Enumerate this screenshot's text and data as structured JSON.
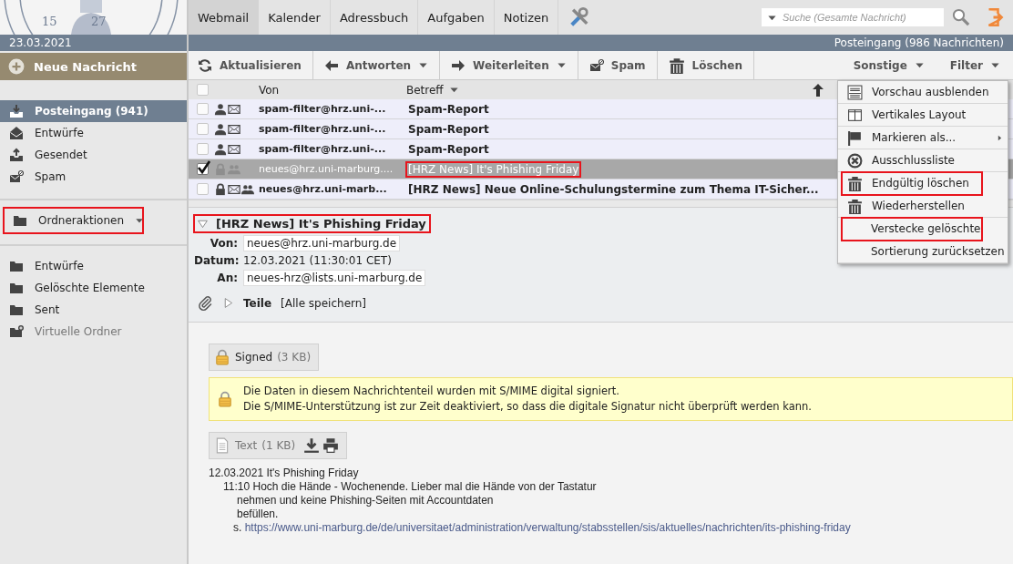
{
  "logo": {
    "numbers": [
      "15",
      "27"
    ]
  },
  "date": "23.03.2021",
  "new_message": "Neue Nachricht",
  "mail_folders": [
    {
      "label": "Posteingang (941)",
      "kind": "inbox",
      "selected": true
    },
    {
      "label": "Entwürfe",
      "kind": "drafts",
      "selected": false
    },
    {
      "label": "Gesendet",
      "kind": "sent",
      "selected": false
    },
    {
      "label": "Spam",
      "kind": "spam",
      "selected": false
    }
  ],
  "folder_actions": {
    "label": "Ordneraktionen",
    "highlighted": true
  },
  "folders": [
    {
      "label": "Entwürfe",
      "kind": "folder",
      "disabled": false
    },
    {
      "label": "Gelöschte Elemente",
      "kind": "folder",
      "disabled": false
    },
    {
      "label": "Sent",
      "kind": "folder",
      "disabled": false
    },
    {
      "label": "Virtuelle Ordner",
      "kind": "virtual",
      "disabled": true
    }
  ],
  "tabs": [
    {
      "label": "Webmail",
      "selected": true
    },
    {
      "label": "Kalender",
      "selected": false
    },
    {
      "label": "Adressbuch",
      "selected": false
    },
    {
      "label": "Aufgaben",
      "selected": false
    },
    {
      "label": "Notizen",
      "selected": false
    }
  ],
  "search": {
    "placeholder": "Suche (Gesamte Nachricht)"
  },
  "mailbox_status": "Posteingang (986 Nachrichten)",
  "toolbar": [
    {
      "label": "Aktualisieren",
      "kind": "refresh",
      "dropdown": false
    },
    {
      "label": "Antworten",
      "kind": "reply",
      "dropdown": true
    },
    {
      "label": "Weiterleiten",
      "kind": "forward",
      "dropdown": true
    },
    {
      "label": "Spam",
      "kind": "spam",
      "dropdown": false
    },
    {
      "label": "Löschen",
      "kind": "trash",
      "dropdown": false
    }
  ],
  "toolbar_right": [
    {
      "label": "Sonstige"
    },
    {
      "label": "Filter"
    }
  ],
  "message_list": {
    "select_all": {
      "checked": false
    },
    "columns": [
      "Von",
      "Betreff"
    ],
    "rows": [
      {
        "from": "spam-filter@hrz.uni-...",
        "subject": "Spam-Report",
        "personal": true,
        "locked": false,
        "mail": true,
        "mailing_list": false,
        "unread": true,
        "checked": false,
        "selected": false,
        "highlighted": false
      },
      {
        "from": "spam-filter@hrz.uni-...",
        "subject": "Spam-Report",
        "personal": true,
        "locked": false,
        "mail": true,
        "mailing_list": false,
        "unread": true,
        "checked": false,
        "selected": false,
        "highlighted": false
      },
      {
        "from": "spam-filter@hrz.uni-...",
        "subject": "Spam-Report",
        "personal": true,
        "locked": false,
        "mail": true,
        "mailing_list": false,
        "unread": true,
        "checked": false,
        "selected": false,
        "highlighted": false
      },
      {
        "from": "neues@hrz.uni-marburg....",
        "subject": "[HRZ News] It's Phishing Friday",
        "personal": false,
        "locked": true,
        "mail": false,
        "mailing_list": true,
        "unread": false,
        "checked": true,
        "selected": true,
        "highlighted": true
      },
      {
        "from": "neues@hrz.uni-marb...",
        "subject": "[HRZ News] Neue Online-Schulungstermine zum Thema IT-Sicher...",
        "personal": false,
        "locked": true,
        "mail": true,
        "mailing_list": true,
        "unread": true,
        "checked": false,
        "selected": false,
        "highlighted": false
      }
    ]
  },
  "preview": {
    "subject": "[HRZ News] It's Phishing Friday",
    "highlighted": true,
    "expanded": true,
    "fields": [
      {
        "label": "Von:",
        "value": "neues@hrz.uni-marburg.de",
        "kind": "address"
      },
      {
        "label": "Datum:",
        "value": "12.03.2021 (11:30:01 CET)",
        "kind": "text"
      },
      {
        "label": "An:",
        "value": "neues-hrz@lists.uni-marburg.de",
        "kind": "address"
      }
    ],
    "parts": {
      "label": "Teile",
      "action": "[Alle speichern]",
      "expanded": false
    }
  },
  "signed_part": {
    "label": "Signed",
    "size": "(3 KB)"
  },
  "notice": [
    "Die Daten in diesem Nachrichtenteil wurden mit S/MIME digital signiert.",
    "Die S/MIME-Unterstützung ist zur Zeit deaktiviert, so dass die digitale Signatur nicht überprüft werden kann."
  ],
  "text_part": {
    "label": "Text",
    "size": "(1 KB)"
  },
  "body": [
    {
      "kind": "plain",
      "text": "12.03.2021 It's Phishing Friday"
    },
    {
      "kind": "indented",
      "text": "11:10 Hoch die Hände - Wochenende. Lieber mal die Hände von der Tastatur"
    },
    {
      "kind": "continued",
      "text": "nehmen und keine Phishing-Seiten mit Accountdaten"
    },
    {
      "kind": "continued",
      "text": "befüllen."
    },
    {
      "kind": "link",
      "prefix": "s.",
      "text": "https://www.uni-marburg.de/de/universitaet/administration/verwaltung/stabsstellen/sis/aktuelles/nachrichten/its-phishing-friday"
    }
  ],
  "menu": [
    {
      "label": "Vorschau ausblenden",
      "kind": "preview",
      "submenu": false,
      "highlighted": false
    },
    {
      "label": "Vertikales Layout",
      "kind": "layout",
      "submenu": false,
      "highlighted": false
    },
    {
      "label": "Markieren als...",
      "kind": "flag",
      "submenu": true,
      "highlighted": false
    },
    {
      "label": "Ausschlussliste",
      "kind": "exclude",
      "submenu": false,
      "highlighted": false
    },
    {
      "label": "Endgültig löschen",
      "kind": "trash",
      "submenu": false,
      "highlighted": true
    },
    {
      "label": "Wiederherstellen",
      "kind": "trash",
      "submenu": false,
      "highlighted": false
    },
    {
      "label": "Verstecke gelöschte",
      "kind": "none",
      "submenu": false,
      "highlighted": true
    },
    {
      "label": "Sortierung zurücksetzen",
      "kind": "none",
      "submenu": false,
      "highlighted": false
    }
  ]
}
